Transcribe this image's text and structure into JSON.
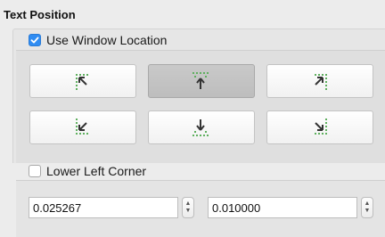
{
  "section": {
    "title": "Text Position"
  },
  "use_window_location": {
    "label": "Use Window Location",
    "checked": true
  },
  "position_buttons": [
    {
      "name": "top-left",
      "icon": "arrow-to-top-left-icon",
      "pressed": false
    },
    {
      "name": "top-center",
      "icon": "arrow-to-top-center-icon",
      "pressed": true
    },
    {
      "name": "top-right",
      "icon": "arrow-to-top-right-icon",
      "pressed": false
    },
    {
      "name": "bottom-left",
      "icon": "arrow-to-bottom-left-icon",
      "pressed": false
    },
    {
      "name": "bottom-center",
      "icon": "arrow-to-bottom-center-icon",
      "pressed": false
    },
    {
      "name": "bottom-right",
      "icon": "arrow-to-bottom-right-icon",
      "pressed": false
    }
  ],
  "lower_left_corner": {
    "label": "Lower Left Corner",
    "checked": false
  },
  "coords": {
    "x": "0.025267",
    "y": "0.010000"
  },
  "colors": {
    "accent": "#2f8cf2",
    "dots": "#5fb05f",
    "arrow": "#333333"
  }
}
